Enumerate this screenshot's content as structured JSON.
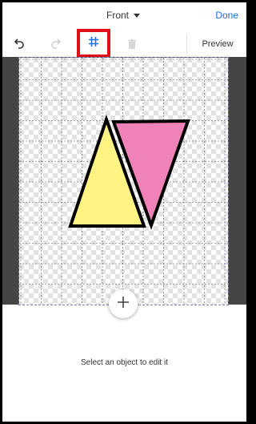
{
  "header": {
    "side_label": "Front",
    "done_label": "Done"
  },
  "toolbar": {
    "undo_icon": "undo-icon",
    "redo_icon": "redo-icon",
    "grid_icon": "grid-icon",
    "delete_icon": "trash-icon",
    "preview_label": "Preview"
  },
  "canvas": {
    "shapes": [
      {
        "type": "triangle",
        "fill": "#fff384",
        "stroke": "#000000"
      },
      {
        "type": "triangle",
        "fill": "#ef82b6",
        "stroke": "#000000"
      }
    ],
    "add_icon": "plus-icon"
  },
  "hint_text": "Select an object to edit it",
  "colors": {
    "accent": "#1a73e8",
    "highlight": "#e0101a",
    "canvas_border": "#7d7fb3"
  }
}
